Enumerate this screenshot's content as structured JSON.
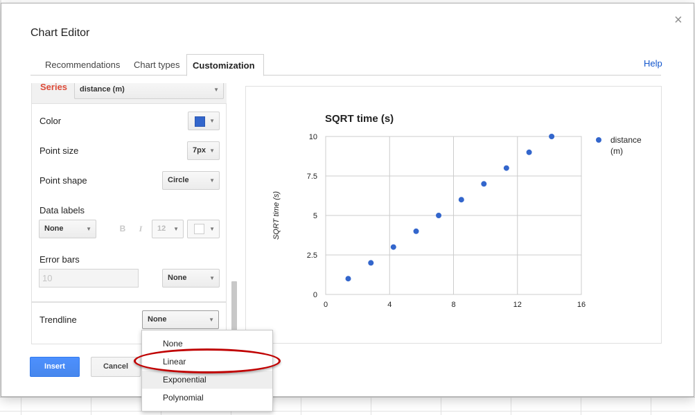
{
  "dialog": {
    "title": "Chart Editor",
    "close_glyph": "×"
  },
  "tabs": [
    {
      "label": "Recommendations",
      "active": false
    },
    {
      "label": "Chart types",
      "active": false
    },
    {
      "label": "Customization",
      "active": true
    }
  ],
  "help_label": "Help",
  "panel": {
    "series_label": "Series",
    "series_value": "distance (m)",
    "color_label": "Color",
    "color_value": "#3366cc",
    "point_size_label": "Point size",
    "point_size_value": "7px",
    "point_shape_label": "Point shape",
    "point_shape_value": "Circle",
    "data_labels_label": "Data labels",
    "data_labels_value": "None",
    "bold_glyph": "B",
    "italic_glyph": "I",
    "font_size_value": "12",
    "error_bars_label": "Error bars",
    "error_bars_input": "10",
    "error_bars_value": "None",
    "trendline_label": "Trendline",
    "trendline_value": "None"
  },
  "trendline_menu": {
    "options": [
      "None",
      "Linear",
      "Exponential",
      "Polynomial"
    ],
    "highlighted": "Exponential",
    "circled": "Linear"
  },
  "buttons": {
    "insert": "Insert",
    "cancel": "Cancel"
  },
  "icons": {
    "close": "close-icon",
    "caret": "chevron-down-icon",
    "color_caret": "chevron-down-icon"
  },
  "colors": {
    "accent": "#3366cc",
    "series_label": "#dd4b39",
    "primary_button": "#4d90fe",
    "highlight_ring": "#c00000",
    "link": "#1155cc"
  },
  "chart_data": {
    "type": "scatter",
    "title": "SQRT time (s)",
    "xlabel": "",
    "ylabel": "SQRT time (s)",
    "xlim": [
      0,
      16
    ],
    "ylim": [
      0,
      10
    ],
    "xticks": [
      "0",
      "4",
      "8",
      "12",
      "16"
    ],
    "yticks": [
      "0",
      "2.5",
      "5",
      "7.5",
      "10"
    ],
    "grid": true,
    "legend": "right",
    "series": [
      {
        "name": "distance (m)",
        "color": "#3366cc",
        "x": [
          1.41,
          2.83,
          4.24,
          5.66,
          7.07,
          8.49,
          9.9,
          11.31,
          12.73,
          14.14
        ],
        "y": [
          1,
          2,
          3,
          4,
          5,
          6,
          7,
          8,
          9,
          10
        ]
      }
    ]
  }
}
